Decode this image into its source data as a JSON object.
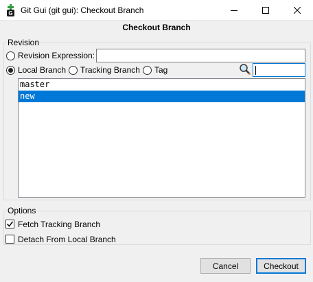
{
  "window": {
    "title": "Git Gui (git gui): Checkout Branch"
  },
  "dialog": {
    "heading": "Checkout Branch"
  },
  "revision": {
    "group_label": "Revision",
    "expression_label": "Revision Expression:",
    "expression_value": "",
    "local_branch_label": "Local Branch",
    "tracking_branch_label": "Tracking Branch",
    "tag_label": "Tag",
    "selected_type": "Local Branch",
    "filter_value": "",
    "branches": [
      "master",
      "new"
    ],
    "selected_branch": "new"
  },
  "options": {
    "group_label": "Options",
    "fetch_tracking_label": "Fetch Tracking Branch",
    "fetch_tracking_checked": true,
    "detach_label": "Detach From Local Branch",
    "detach_checked": false
  },
  "buttons": {
    "cancel": "Cancel",
    "checkout": "Checkout"
  },
  "colors": {
    "accent": "#0078d7",
    "selection": "#0078d7",
    "app_icon_green": "#2e9e3e"
  }
}
